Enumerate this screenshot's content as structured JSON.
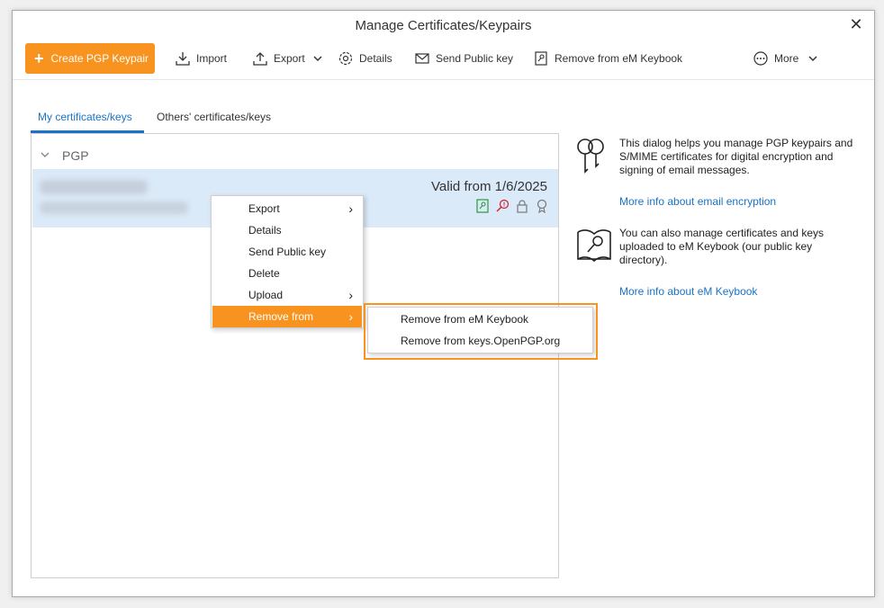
{
  "window": {
    "title": "Manage Certificates/Keypairs"
  },
  "toolbar": {
    "create": "Create PGP Keypair",
    "import": "Import",
    "export": "Export",
    "details": "Details",
    "send_public_key": "Send Public key",
    "remove_keybook": "Remove from eM Keybook",
    "more": "More"
  },
  "tabs": [
    {
      "label": "My certificates/keys",
      "active": true
    },
    {
      "label": "Others' certificates/keys",
      "active": false
    }
  ],
  "list": {
    "group": "PGP",
    "row": {
      "valid_from": "Valid from 1/6/2025"
    }
  },
  "context_menu": {
    "items": [
      {
        "label": "Export",
        "submenu": true
      },
      {
        "label": "Details",
        "submenu": false
      },
      {
        "label": "Send Public key",
        "submenu": false
      },
      {
        "label": "Delete",
        "submenu": false
      },
      {
        "label": "Upload",
        "submenu": true
      },
      {
        "label": "Remove from",
        "submenu": true,
        "highlighted": true
      }
    ]
  },
  "submenu": {
    "items": [
      {
        "label": "Remove from eM Keybook"
      },
      {
        "label": "Remove from keys.OpenPGP.org"
      }
    ]
  },
  "info": {
    "text1": "This dialog helps you manage PGP keypairs and S/MIME certificates for digital encryption and signing of email messages.",
    "link1": "More info about email encryption",
    "text2": "You can also manage certificates and keys uploaded to eM Keybook (our public key directory).",
    "link2": "More info about eM Keybook"
  },
  "colors": {
    "accent": "#f7931e",
    "link": "#1a73c8",
    "selection": "#dbeaf8"
  }
}
